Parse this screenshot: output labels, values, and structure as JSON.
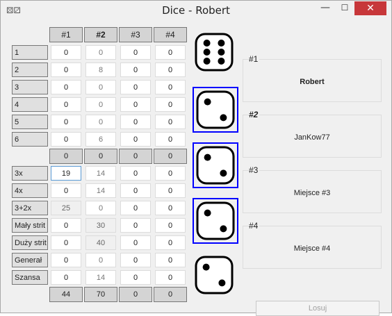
{
  "window": {
    "title": "Dice - Robert",
    "icon": "dice-icon",
    "minimize": "—",
    "maximize": "☐",
    "close": "✕"
  },
  "columns": [
    "#1",
    "#2",
    "#3",
    "#4"
  ],
  "upper_rows": [
    {
      "label": "1",
      "values": [
        "0",
        "0",
        "0",
        "0"
      ]
    },
    {
      "label": "2",
      "values": [
        "0",
        "8",
        "0",
        "0"
      ]
    },
    {
      "label": "3",
      "values": [
        "0",
        "0",
        "0",
        "0"
      ]
    },
    {
      "label": "4",
      "values": [
        "0",
        "0",
        "0",
        "0"
      ]
    },
    {
      "label": "5",
      "values": [
        "0",
        "0",
        "0",
        "0"
      ]
    },
    {
      "label": "6",
      "values": [
        "0",
        "6",
        "0",
        "0"
      ]
    }
  ],
  "upper_totals": [
    "0",
    "0",
    "0",
    "0"
  ],
  "lower_rows": [
    {
      "label": "3x",
      "values": [
        "19",
        "14",
        "0",
        "0"
      ]
    },
    {
      "label": "4x",
      "values": [
        "0",
        "14",
        "0",
        "0"
      ]
    },
    {
      "label": "3+2x",
      "values": [
        "25",
        "0",
        "0",
        "0"
      ]
    },
    {
      "label": "Mały strit",
      "values": [
        "0",
        "30",
        "0",
        "0"
      ]
    },
    {
      "label": "Duży strit",
      "values": [
        "0",
        "40",
        "0",
        "0"
      ]
    },
    {
      "label": "Generał",
      "values": [
        "0",
        "0",
        "0",
        "0"
      ]
    },
    {
      "label": "Szansa",
      "values": [
        "0",
        "14",
        "0",
        "0"
      ]
    }
  ],
  "grand_totals": [
    "44",
    "70",
    "0",
    "0"
  ],
  "dice": [
    {
      "value": 6,
      "held": false
    },
    {
      "value": 2,
      "held": true
    },
    {
      "value": 2,
      "held": true
    },
    {
      "value": 2,
      "held": true
    },
    {
      "value": 2,
      "held": false
    }
  ],
  "players": [
    {
      "label": "#1",
      "name": "Robert"
    },
    {
      "label": "#2",
      "name": "JanKow77"
    },
    {
      "label": "#3",
      "name": "Miejsce #3"
    },
    {
      "label": "#4",
      "name": "Miejsce #4"
    }
  ],
  "roll_button": "Losuj",
  "accent": "#0000ff"
}
